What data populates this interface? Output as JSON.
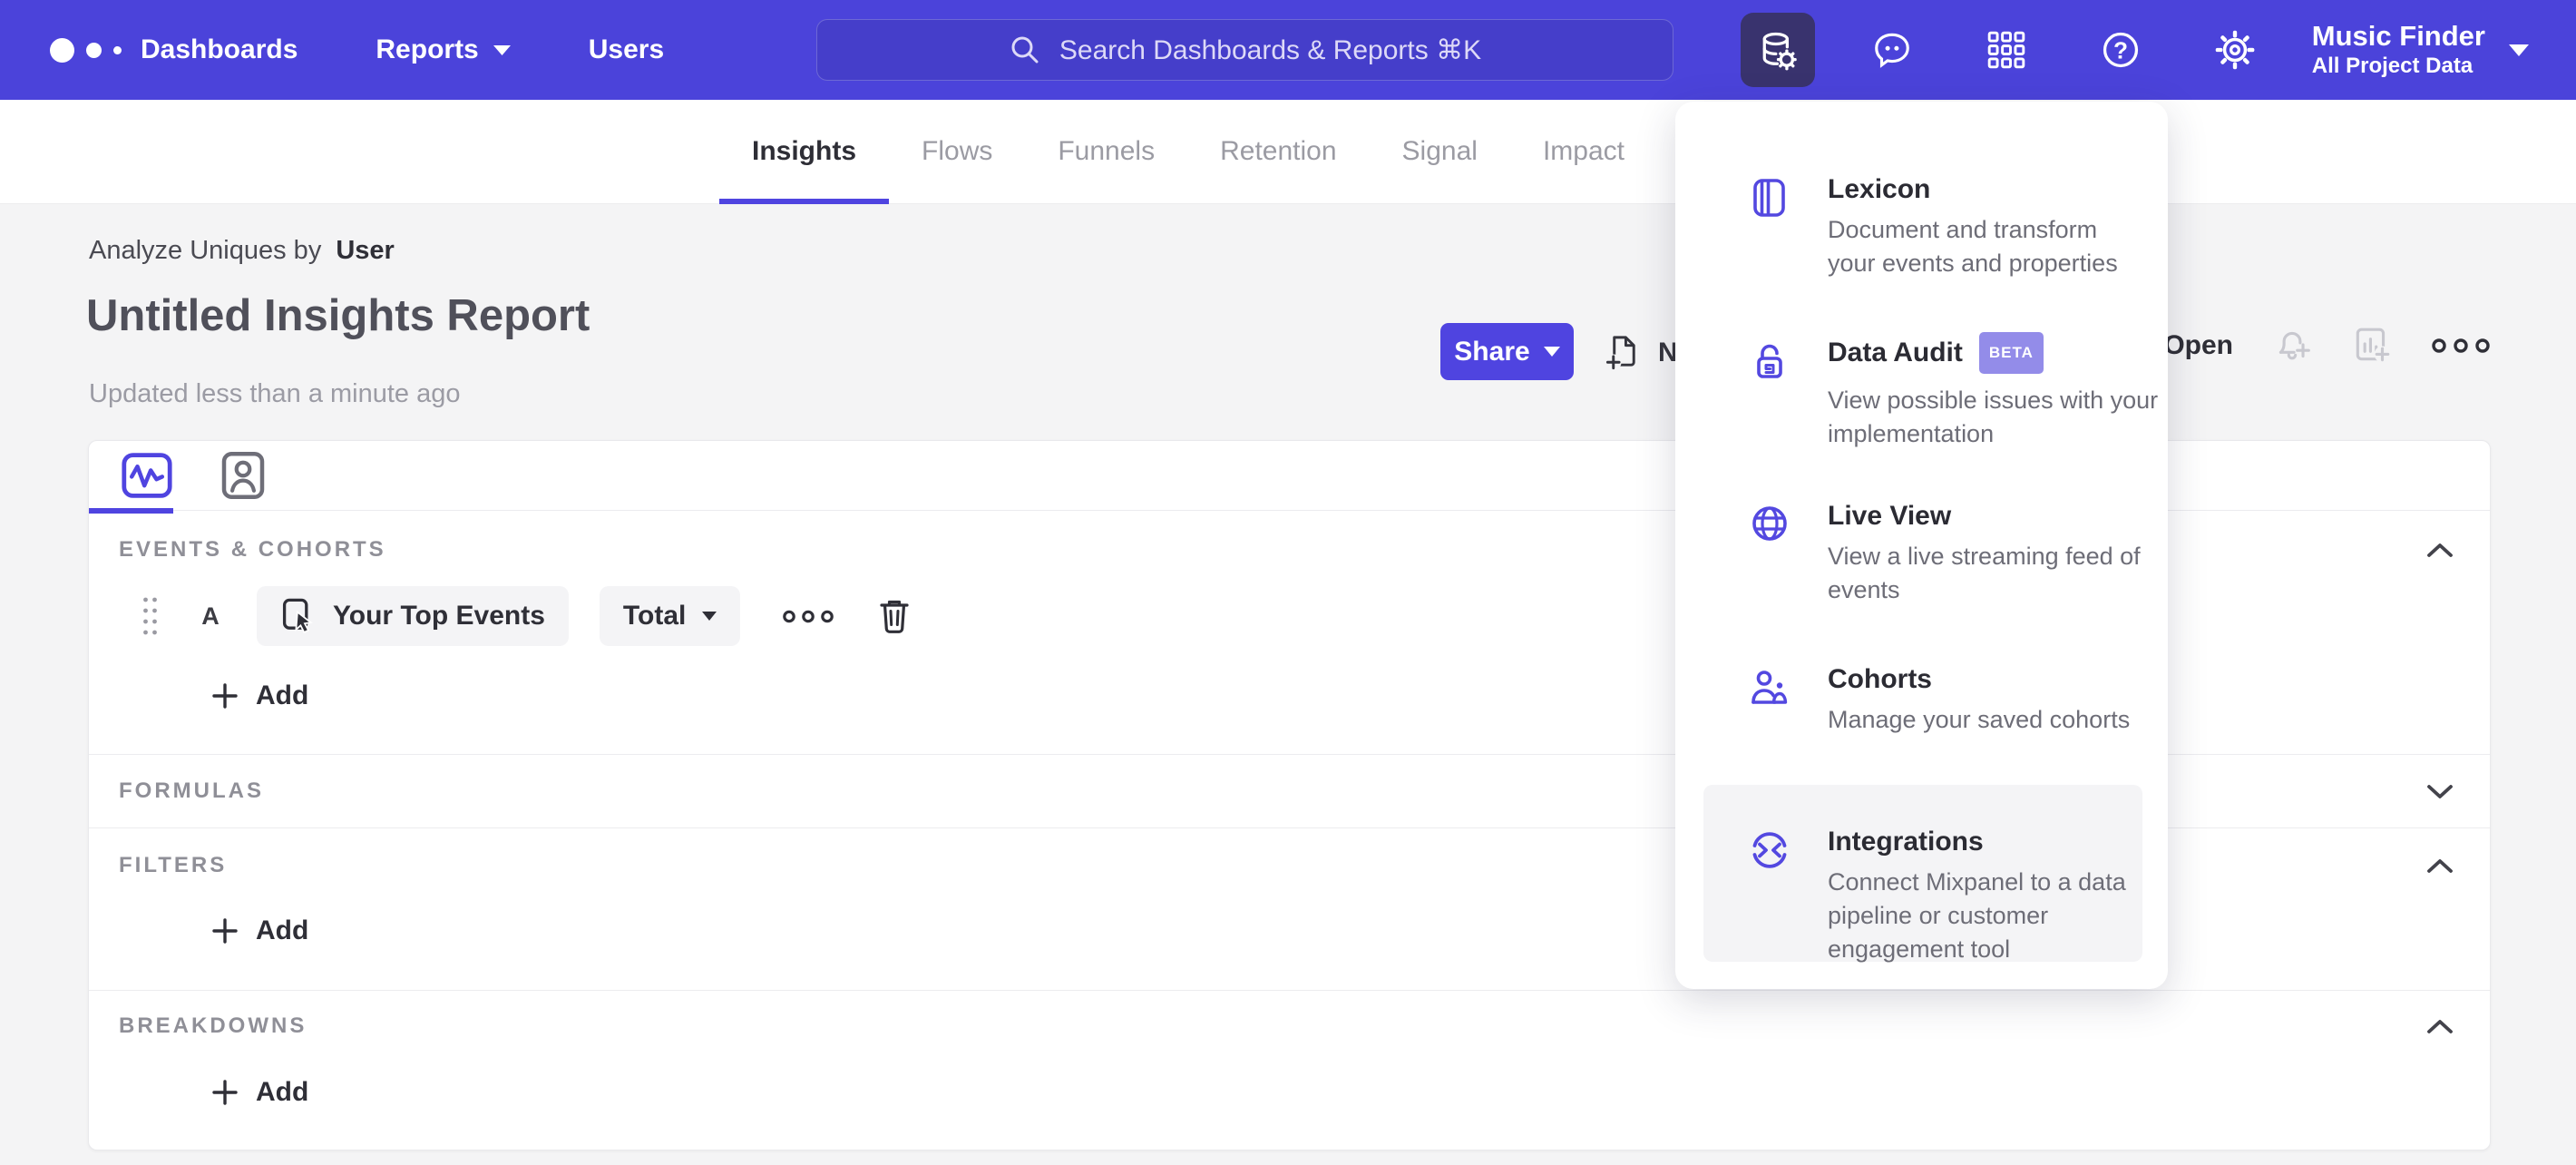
{
  "colors": {
    "brand_purple": "#4b43da",
    "accent": "#4f44e0",
    "active_icon_tile": "#39336e",
    "beta_badge": "#938ce9",
    "page_background": "#f4f4f5"
  },
  "topnav": {
    "items": [
      {
        "label": "Dashboards"
      },
      {
        "label": "Reports"
      },
      {
        "label": "Users"
      }
    ],
    "search_placeholder": "Search Dashboards & Reports ⌘K",
    "project": {
      "name": "Music Finder",
      "scope": "All Project Data"
    }
  },
  "tabs": {
    "items": [
      "Insights",
      "Flows",
      "Funnels",
      "Retention",
      "Signal",
      "Impact"
    ],
    "active": "Insights"
  },
  "report": {
    "analyze_prefix": "Analyze Uniques by",
    "analyze_entity": "User",
    "title": "Untitled Insights Report",
    "updated": "Updated less than a minute ago"
  },
  "actions": {
    "share": "Share",
    "new": "New",
    "open": "Open"
  },
  "menu": {
    "items": [
      {
        "title": "Lexicon",
        "desc": "Document and transform your events and properties"
      },
      {
        "title": "Data Audit",
        "badge": "BETA",
        "desc": "View possible issues with your implementation"
      },
      {
        "title": "Live View",
        "desc": "View a live streaming feed of events"
      },
      {
        "title": "Cohorts",
        "desc": "Manage your saved cohorts"
      },
      {
        "title": "Integrations",
        "desc": "Connect Mixpanel to a data pipeline or customer engagement tool"
      }
    ]
  },
  "builder": {
    "sections": {
      "events": "EVENTS & COHORTS",
      "formulas": "FORMULAS",
      "filters": "FILTERS",
      "breakdowns": "BREAKDOWNS"
    },
    "event_row": {
      "letter": "A",
      "event": "Your Top Events",
      "metric": "Total"
    },
    "add_label": "Add"
  }
}
